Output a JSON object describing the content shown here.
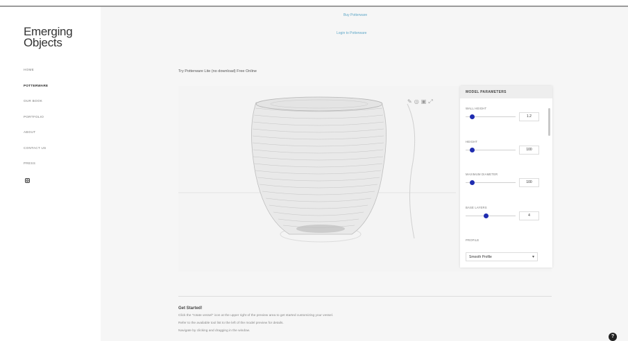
{
  "brand": {
    "line1": "Emerging",
    "line2": "Objects"
  },
  "nav": {
    "items": [
      {
        "label": "HOME",
        "active": false
      },
      {
        "label": "POTTERWARE",
        "active": true
      },
      {
        "label": "OUR BOOK",
        "active": false
      },
      {
        "label": "PORTFOLIO",
        "active": false
      },
      {
        "label": "ABOUT",
        "active": false
      },
      {
        "label": "CONTACT US",
        "active": false
      },
      {
        "label": "PRESS",
        "active": false
      }
    ],
    "social_icon": "instagram-icon"
  },
  "top_links": {
    "buy": "Buy Potterware",
    "login": "Login to Potterware"
  },
  "intro": "Try Potterware Lite (no download) Free Online",
  "viewer": {
    "icons": [
      "pencil-icon",
      "eye-icon",
      "camera-icon",
      "expand-icon"
    ]
  },
  "panel": {
    "title": "MODEL PARAMETERS",
    "params": [
      {
        "label": "WALL HEIGHT",
        "value": "1.2",
        "level": 0.1
      },
      {
        "label": "HEIGHT",
        "value": "100",
        "level": 0.1
      },
      {
        "label": "MAXIMUM DIAMETER",
        "value": "100",
        "level": 0.1
      },
      {
        "label": "BASE LAYERS",
        "value": "4",
        "level": 0.4
      }
    ],
    "profile_label": "PROFILE",
    "profile_value": "Smooth Profile"
  },
  "getting_started": {
    "title": "Get Started!",
    "lines": [
      "Click the \"rotate vessel\" icon at the upper right of the preview area to get started customizing your vessel.",
      "Refer to the available tool list to the left of the model preview for details.",
      "Navigate by clicking and dragging in the window."
    ]
  },
  "colors": {
    "accent": "#1f2cb0",
    "link": "#5fa7c7",
    "background": "#f6f6f6"
  },
  "help_button": {
    "label": "?"
  }
}
